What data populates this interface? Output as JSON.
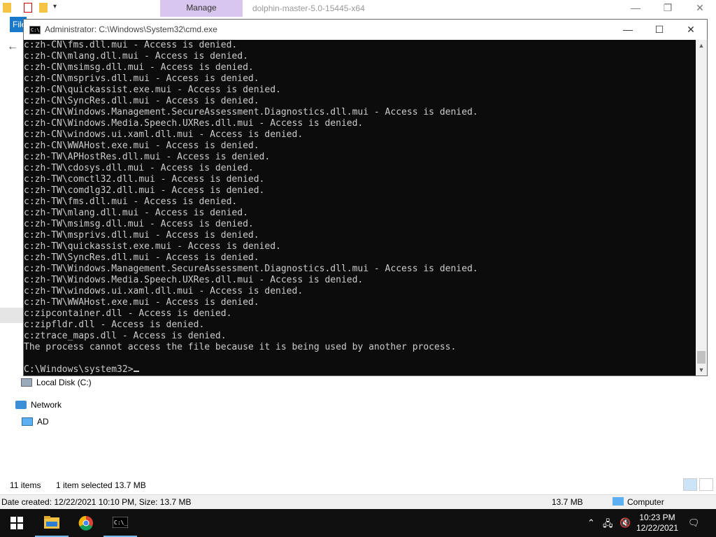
{
  "explorer": {
    "manage_tab": "Manage",
    "title": "dolphin-master-5.0-15445-x64",
    "file_tab": "File",
    "nav": {
      "local_disk": "Local Disk (C:)",
      "network": "Network",
      "ad": "AD"
    },
    "status": {
      "item_count": "11 items",
      "selection": "1 item selected  13.7 MB"
    },
    "details": {
      "info": "Date created: 12/22/2021 10:10 PM, Size: 13.7 MB",
      "size": "13.7 MB",
      "location": "Computer"
    }
  },
  "cmd": {
    "title": "Administrator: C:\\Windows\\System32\\cmd.exe",
    "lines": [
      "c:zh-CN\\fms.dll.mui - Access is denied.",
      "c:zh-CN\\mlang.dll.mui - Access is denied.",
      "c:zh-CN\\msimsg.dll.mui - Access is denied.",
      "c:zh-CN\\msprivs.dll.mui - Access is denied.",
      "c:zh-CN\\quickassist.exe.mui - Access is denied.",
      "c:zh-CN\\SyncRes.dll.mui - Access is denied.",
      "c:zh-CN\\Windows.Management.SecureAssessment.Diagnostics.dll.mui - Access is denied.",
      "c:zh-CN\\Windows.Media.Speech.UXRes.dll.mui - Access is denied.",
      "c:zh-CN\\windows.ui.xaml.dll.mui - Access is denied.",
      "c:zh-CN\\WWAHost.exe.mui - Access is denied.",
      "c:zh-TW\\APHostRes.dll.mui - Access is denied.",
      "c:zh-TW\\cdosys.dll.mui - Access is denied.",
      "c:zh-TW\\comctl32.dll.mui - Access is denied.",
      "c:zh-TW\\comdlg32.dll.mui - Access is denied.",
      "c:zh-TW\\fms.dll.mui - Access is denied.",
      "c:zh-TW\\mlang.dll.mui - Access is denied.",
      "c:zh-TW\\msimsg.dll.mui - Access is denied.",
      "c:zh-TW\\msprivs.dll.mui - Access is denied.",
      "c:zh-TW\\quickassist.exe.mui - Access is denied.",
      "c:zh-TW\\SyncRes.dll.mui - Access is denied.",
      "c:zh-TW\\Windows.Management.SecureAssessment.Diagnostics.dll.mui - Access is denied.",
      "c:zh-TW\\Windows.Media.Speech.UXRes.dll.mui - Access is denied.",
      "c:zh-TW\\windows.ui.xaml.dll.mui - Access is denied.",
      "c:zh-TW\\WWAHost.exe.mui - Access is denied.",
      "c:zipcontainer.dll - Access is denied.",
      "c:zipfldr.dll - Access is denied.",
      "c:ztrace_maps.dll - Access is denied.",
      "The process cannot access the file because it is being used by another process.",
      ""
    ],
    "prompt": "C:\\Windows\\system32>"
  },
  "taskbar": {
    "time": "10:23 PM",
    "date": "12/22/2021",
    "icons": [
      "windows-start-icon",
      "file-explorer-icon",
      "chrome-icon",
      "cmd-icon"
    ]
  },
  "colors": {
    "console_bg": "#0c0c0c",
    "console_fg": "#cccccc",
    "manage_tab": "#d8c6ee",
    "taskbar": "#101010"
  }
}
